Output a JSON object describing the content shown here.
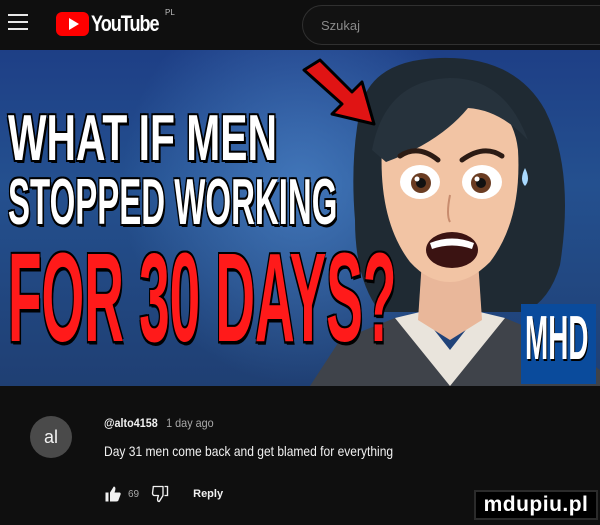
{
  "header": {
    "logo_text": "YouTube",
    "region": "PL",
    "search_placeholder": "Szukaj"
  },
  "thumbnail": {
    "line1": "WHAT IF MEN",
    "line2": "STOPPED WORKING",
    "line3": "FOR 30 DAYS?",
    "badge": "MHD"
  },
  "comment": {
    "avatar_initials": "al",
    "author": "@alto4158",
    "time": "1 day ago",
    "text": "Day 31 men come back and get blamed for everything",
    "like_count": "69",
    "reply_label": "Reply"
  },
  "watermark": "mdupiu.pl",
  "colors": {
    "background": "#0f0f0f",
    "youtube_red": "#ff0000",
    "headline_red": "#ff1a1a",
    "thumb_blue": "#24508f"
  }
}
